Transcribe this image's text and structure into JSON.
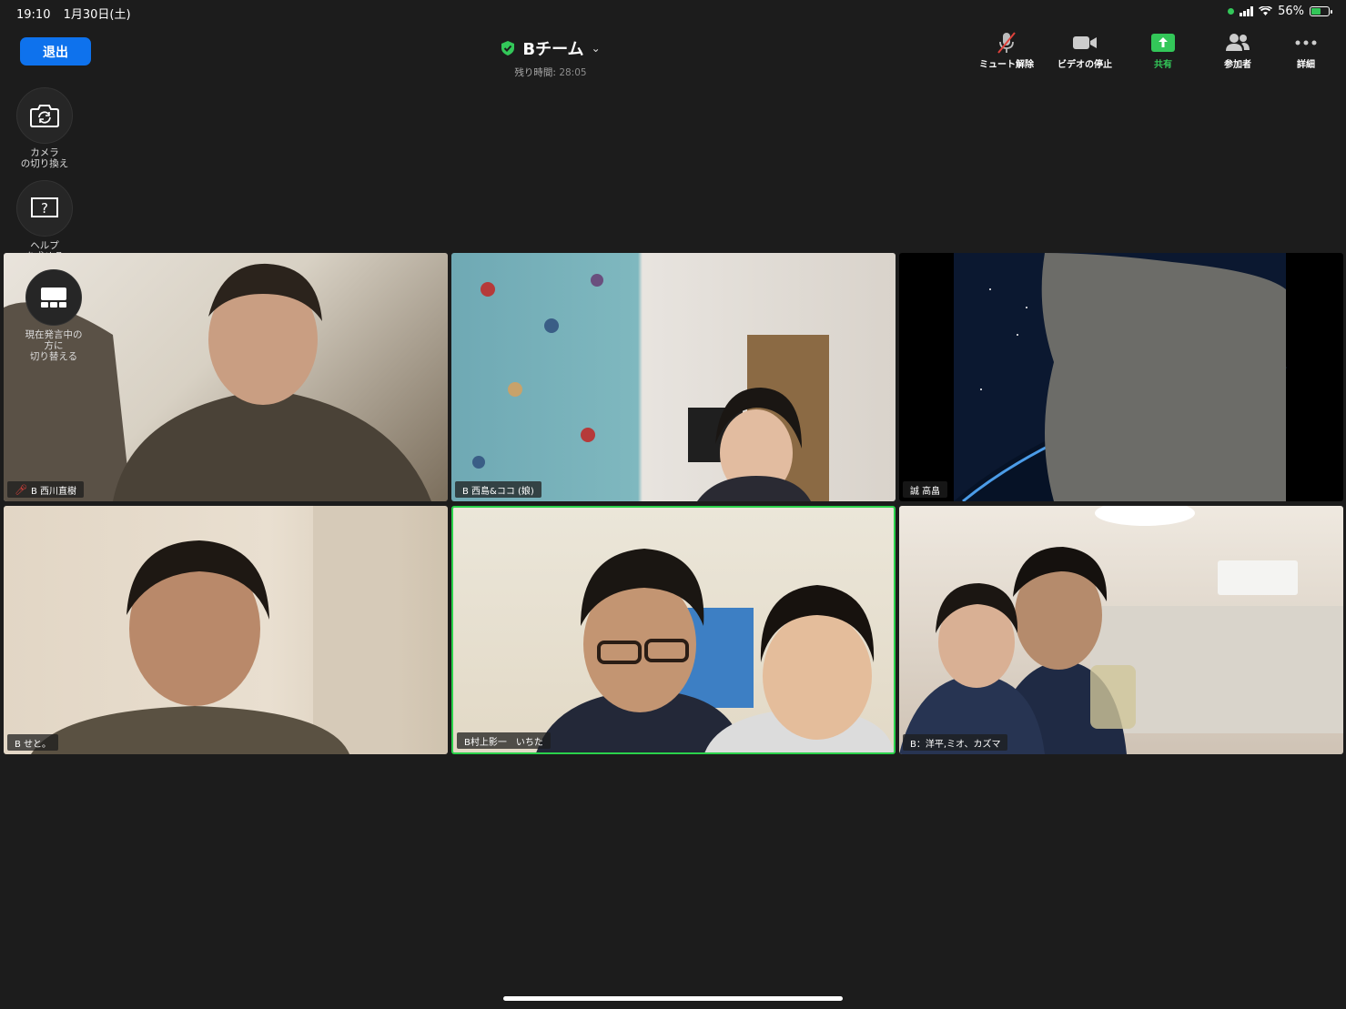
{
  "status": {
    "time": "19:10",
    "date": "1月30日(土)",
    "battery": "56%",
    "battery_level": 0.56
  },
  "header": {
    "exit_label": "退出",
    "title": "Bチーム",
    "timer_label": "残り時間:",
    "timer_value": "28:05"
  },
  "toolbar": {
    "unmute": "ミュート解除",
    "stop_video": "ビデオの停止",
    "share": "共有",
    "participants": "参加者",
    "more": "詳細"
  },
  "side": {
    "switch_camera": "カメラ\nの切り換え",
    "help": "ヘルプ\nを求める",
    "speaker_view": "現在発言中の\n方に\n切り替える"
  },
  "participants": [
    {
      "name": "B 西川直樹",
      "muted": true
    },
    {
      "name": "B 西島&ココ (娘)",
      "muted": false
    },
    {
      "name": "誠 高畠",
      "muted": false
    },
    {
      "name": "B せと。",
      "muted": false
    },
    {
      "name": "B村上影一　いちた",
      "muted": false,
      "active": true
    },
    {
      "name": "B：洋平,ミオ、カズマ",
      "muted": false
    }
  ],
  "colors": {
    "accent": "#0e72ed",
    "share_green": "#33c759",
    "active_border": "#2bd24b",
    "muted_red": "#e0413b"
  }
}
